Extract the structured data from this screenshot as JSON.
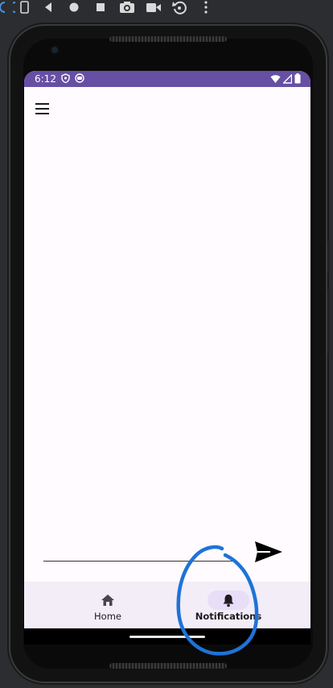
{
  "emulator_toolbar": {
    "buttons": [
      {
        "name": "rotate-left-icon"
      },
      {
        "name": "device-icon"
      },
      {
        "name": "back-icon"
      },
      {
        "name": "home-icon"
      },
      {
        "name": "overview-icon"
      },
      {
        "name": "screenshot-icon"
      },
      {
        "name": "record-icon"
      },
      {
        "name": "reset-icon"
      },
      {
        "name": "more-icon"
      }
    ]
  },
  "status_bar": {
    "time": "6:12",
    "color": "#6750a4"
  },
  "composer": {
    "input_value": "",
    "input_placeholder": ""
  },
  "bottom_nav": {
    "items": [
      {
        "label": "Home",
        "icon": "home-icon",
        "selected": false
      },
      {
        "label": "Notifications",
        "icon": "bell-icon",
        "selected": true
      }
    ]
  },
  "colors": {
    "screen_bg": "#fffbfe",
    "nav_bg": "#f2edf7",
    "nav_indicator": "#e8def8",
    "annotation": "#1e73d8"
  }
}
